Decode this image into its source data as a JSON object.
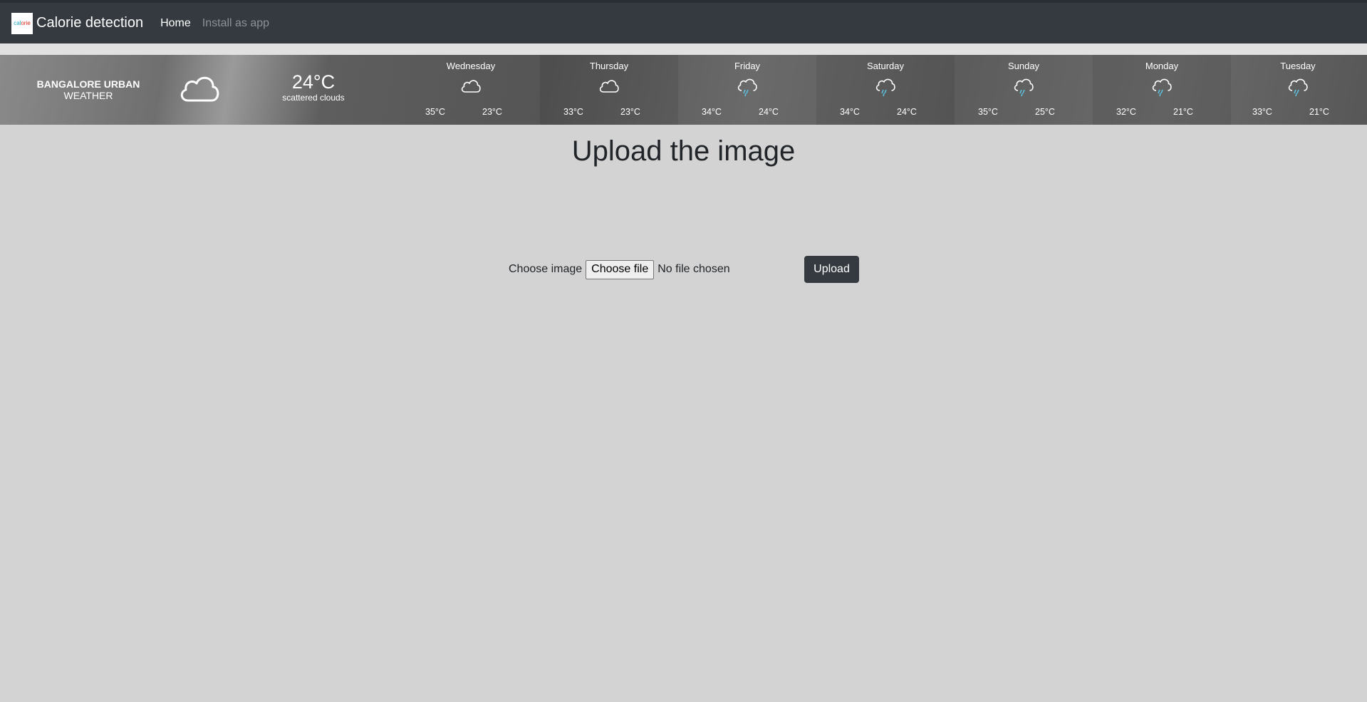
{
  "navbar": {
    "logo_text_a": "cal",
    "logo_text_b": "orie",
    "brand": "Calorie detection",
    "links": [
      {
        "label": "Home",
        "active": true
      },
      {
        "label": "Install as app",
        "active": false
      }
    ]
  },
  "weather": {
    "location": "BANGALORE URBAN",
    "subtitle": "WEATHER",
    "current_icon": "cloud-icon",
    "current_temp": "24°C",
    "current_desc": "scattered clouds",
    "days": [
      {
        "name": "Wednesday",
        "icon": "cloud-icon",
        "high": "35°C",
        "low": "23°C"
      },
      {
        "name": "Thursday",
        "icon": "cloud-icon",
        "high": "33°C",
        "low": "23°C"
      },
      {
        "name": "Friday",
        "icon": "rain-cloud-icon",
        "high": "34°C",
        "low": "24°C"
      },
      {
        "name": "Saturday",
        "icon": "rain-cloud-icon",
        "high": "34°C",
        "low": "24°C"
      },
      {
        "name": "Sunday",
        "icon": "rain-cloud-icon",
        "high": "35°C",
        "low": "25°C"
      },
      {
        "name": "Monday",
        "icon": "rain-cloud-icon",
        "high": "32°C",
        "low": "21°C"
      },
      {
        "name": "Tuesday",
        "icon": "rain-cloud-icon",
        "high": "33°C",
        "low": "21°C"
      }
    ]
  },
  "main": {
    "title": "Upload the image",
    "choose_label": "Choose image",
    "file_button": "Choose file",
    "file_status": "No file chosen",
    "upload_button": "Upload"
  },
  "colors": {
    "navbar_bg": "#343a40",
    "page_bg": "#d3d3d3",
    "rain_drop": "#5bc0de"
  }
}
